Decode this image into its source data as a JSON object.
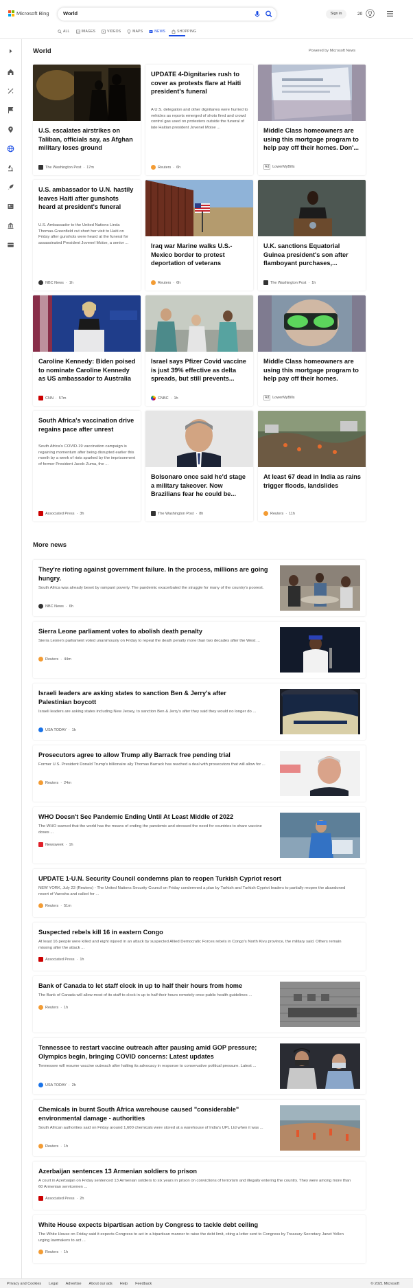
{
  "header": {
    "brand_name": "Microsoft Bing",
    "search_value": "World",
    "sign_in_label": "Sign in",
    "reward_count": "20"
  },
  "scope_tabs": [
    {
      "label": "ALL",
      "icon": "search-icon",
      "active": false
    },
    {
      "label": "IMAGES",
      "icon": "image-icon",
      "active": false
    },
    {
      "label": "VIDEOS",
      "icon": "video-icon",
      "active": false
    },
    {
      "label": "MAPS",
      "icon": "map-pin-icon",
      "active": false
    },
    {
      "label": "NEWS",
      "icon": "news-icon",
      "active": true
    },
    {
      "label": "SHOPPING",
      "icon": "shopping-bag-icon",
      "active": false
    }
  ],
  "rail_icons": [
    "expand-arrow-icon",
    "home-icon",
    "discover-icon",
    "flag-icon",
    "location-pin-icon",
    "globe-icon",
    "microscope-icon",
    "rocket-icon",
    "newspaper-icon",
    "finance-icon",
    "wallet-icon"
  ],
  "main": {
    "section_title": "World",
    "powered_by": "Powered by Microsoft News",
    "cards": [
      {
        "title": "U.S. escalates airstrikes on Taliban, officials say, as Afghan military loses ground",
        "snippet": "",
        "source": "The Washington Post",
        "time": "17m",
        "ad": false
      },
      {
        "title": "UPDATE 4-Dignitaries rush to cover as protests flare at Haiti president's funeral",
        "snippet": "A U.S. delegation and other dignitaries were hurried to vehicles as reports emerged of shots fired and crowd control gas used on protesters outside the funeral of late Haitian president Jovenel Moise ...",
        "source": "Reuters",
        "time": "6h",
        "ad": false
      },
      {
        "title": "Middle Class homeowners are using this mortgage program to help pay off their homes. Don'...",
        "snippet": "",
        "source": "LowerMyBills",
        "time": "",
        "ad": true,
        "ad_label": "Ad"
      },
      {
        "title": "U.S. ambassador to U.N. hastily leaves Haiti after gunshots heard at president's funeral",
        "snippet": "U.S. Ambassador to the United Nations Linda Thomas-Greenfield cut short her visit to Haiti on Friday after gunshots were heard at the funeral for assassinated President Jovenel Moïse, a senior ...",
        "source": "NBC News",
        "time": "1h",
        "ad": false
      },
      {
        "title": "Iraq war Marine walks U.S.-Mexico border to protest deportation of veterans",
        "snippet": "",
        "source": "Reuters",
        "time": "6h",
        "ad": false
      },
      {
        "title": "U.K. sanctions Equatorial Guinea president's son after flamboyant purchases,...",
        "snippet": "",
        "source": "The Washington Post",
        "time": "1h",
        "ad": false
      },
      {
        "title": "Caroline Kennedy: Biden poised to nominate Caroline Kennedy as US ambassador to Australia",
        "snippet": "",
        "source": "CNN",
        "time": "57m",
        "ad": false
      },
      {
        "title": "Israel says Pfizer Covid vaccine is just 39% effective as delta spreads, but still prevents...",
        "snippet": "",
        "source": "CNBC",
        "time": "1h",
        "ad": false
      },
      {
        "title": "Middle Class homeowners are using this mortgage program to help pay off their homes.",
        "snippet": "",
        "source": "LowerMyBills",
        "time": "",
        "ad": true,
        "ad_label": "Ad"
      },
      {
        "title": "South Africa's vaccination drive regains pace after unrest",
        "snippet": "South Africa's COVID-19 vaccination campaign is regaining momentum after being disrupted earlier this month by a week of riots sparked by the imprisonment of former President Jacob Zuma, the ...",
        "source": "Associated Press",
        "time": "3h",
        "ad": false
      },
      {
        "title": "Bolsonaro once said he'd stage a military takeover. Now Brazilians fear he could be...",
        "snippet": "",
        "source": "The Washington Post",
        "time": "8h",
        "ad": false
      },
      {
        "title": "At least 67 dead in India as rains trigger floods, landslides",
        "snippet": "",
        "source": "Reuters",
        "time": "11h",
        "ad": false
      }
    ]
  },
  "more_news": {
    "title": "More news",
    "items": [
      {
        "title": "They're rioting against government failure. In the process, millions are going hungry.",
        "snippet": "South Africa was already beset by rampant poverty. The pandemic exacerbated the struggle for many of the country's poorest.",
        "source": "NBC News",
        "time": "6h"
      },
      {
        "title": "Sierra Leone parliament votes to abolish death penalty",
        "snippet": "Sierra Leone's parliament voted unanimously on Friday to repeal the death penalty more than two decades after the West ...",
        "source": "Reuters",
        "time": "44m"
      },
      {
        "title": "Israeli leaders are asking states to sanction Ben & Jerry's after Palestinian boycott",
        "snippet": "Israeli leaders are asking states including New Jersey, to sanction Ben & Jerry's after they said they would no longer do ...",
        "source": "USA TODAY",
        "time": "1h"
      },
      {
        "title": "Prosecutors agree to allow Trump ally Barrack free pending trial",
        "snippet": "Former U.S. President Donald Trump's billionaire ally Thomas Barrack has reached a deal with prosecutors that will allow for ...",
        "source": "Reuters",
        "time": "24m"
      },
      {
        "title": "WHO Doesn't See Pandemic Ending Until At Least Middle of 2022",
        "snippet": "The WHO warned that the world has the means of ending the pandemic and stressed the need for countries to share vaccine doses ...",
        "source": "Newsweek",
        "time": "1h"
      },
      {
        "title": "UPDATE 1-U.N. Security Council condemns plan to reopen Turkish Cypriot resort",
        "snippet": "NEW YORK, July 23 (Reuters) - The United Nations Security Council on Friday condemned a plan by Turkish and Turkish Cypriot leaders to partially reopen the abandoned resort of Varosha and called for ...",
        "source": "Reuters",
        "time": "51m"
      },
      {
        "title": "Suspected rebels kill 16 in eastern Congo",
        "snippet": "At least 16 people were killed and eight injured in an attack by suspected Allied Democratic Forces rebels in Congo's North Kivu province, the military said. Others remain missing after the attack ...",
        "source": "Associated Press",
        "time": "1h"
      },
      {
        "title": "Bank of Canada to let staff clock in up to half their hours from home",
        "snippet": "The Bank of Canada will allow most of its staff to clock in up to half their hours remotely once public health guidelines ...",
        "source": "Reuters",
        "time": "1h"
      },
      {
        "title": "Tennessee to restart vaccine outreach after pausing amid GOP pressure; Olympics begin, bringing COVID concerns: Latest updates",
        "snippet": "Tennessee will resume vaccine outreach after halting its advocacy in response to conservative political pressure. Latest ...",
        "source": "USA TODAY",
        "time": "2h"
      },
      {
        "title": "Chemicals in burnt South Africa warehouse caused \"considerable\" environmental damage - authorities",
        "snippet": "South African authorities said on Friday around 1,600 chemicals were stored at a warehouse of India's UPL Ltd when it was ...",
        "source": "Reuters",
        "time": "1h"
      },
      {
        "title": "Azerbaijan sentences 13 Armenian soldiers to prison",
        "snippet": "A court in Azerbaijan on Friday sentenced 13 Armenian soldiers to six years in prison on convictions of terrorism and illegally entering the country. They were among more than 60 Armenian servicemen ...",
        "source": "Associated Press",
        "time": "2h"
      },
      {
        "title": "White House expects bipartisan action by Congress to tackle debt ceiling",
        "snippet": "The White House on Friday said it expects Congress to act in a bipartisan manner to raise the debt limit, citing a letter sent to Congress by Treasury Secretary Janet Yellen urging lawmakers to act ...",
        "source": "Reuters",
        "time": "1h"
      }
    ]
  },
  "footer": {
    "links": [
      "Privacy and Cookies",
      "Legal",
      "Advertise",
      "About our ads",
      "Help",
      "Feedback"
    ],
    "copyright": "© 2021 Microsoft"
  },
  "colors": {
    "accent": "#174ae4",
    "logo_red": "#f25022",
    "logo_green": "#7fba00",
    "logo_blue": "#00a4ef",
    "logo_yellow": "#ffb900"
  }
}
